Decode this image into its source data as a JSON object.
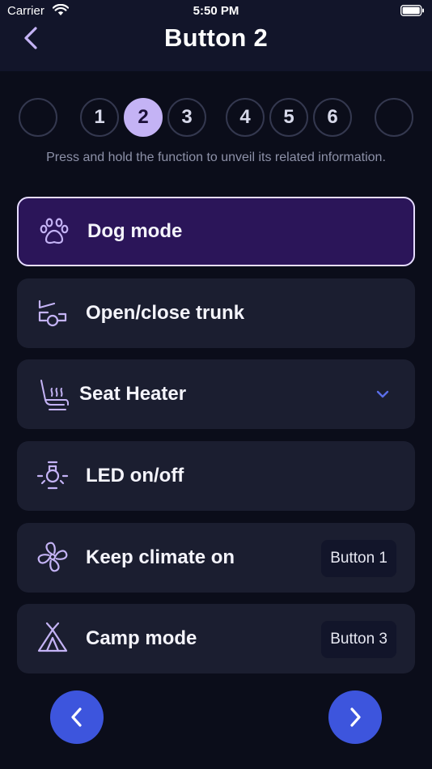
{
  "status": {
    "carrier": "Carrier",
    "time": "5:50 PM"
  },
  "header": {
    "title": "Button 2"
  },
  "steps": [
    {
      "label": ""
    },
    {
      "label": "1"
    },
    {
      "label": "2"
    },
    {
      "label": "3"
    },
    {
      "label": "4"
    },
    {
      "label": "5"
    },
    {
      "label": "6"
    },
    {
      "label": ""
    }
  ],
  "active_step": "2",
  "hint": "Press and hold the function to unveil its related information.",
  "functions": [
    {
      "label": "Dog mode",
      "icon": "paw-icon",
      "selected": true
    },
    {
      "label": "Open/close trunk",
      "icon": "trunk-icon"
    },
    {
      "label": "Seat Heater",
      "icon": "seat-heater-icon",
      "expandable": true
    },
    {
      "label": "LED on/off",
      "icon": "light-bulb-icon"
    },
    {
      "label": "Keep climate on",
      "icon": "fan-icon",
      "assigned": "Button 1"
    },
    {
      "label": "Camp mode",
      "icon": "tent-icon",
      "assigned": "Button 3"
    }
  ],
  "colors": {
    "accent": "#c4b3f5",
    "selected_bg": "#2b1559",
    "card_bg": "#1b1e30",
    "nav_button": "#3d55dd",
    "background": "#0b0d1a"
  }
}
